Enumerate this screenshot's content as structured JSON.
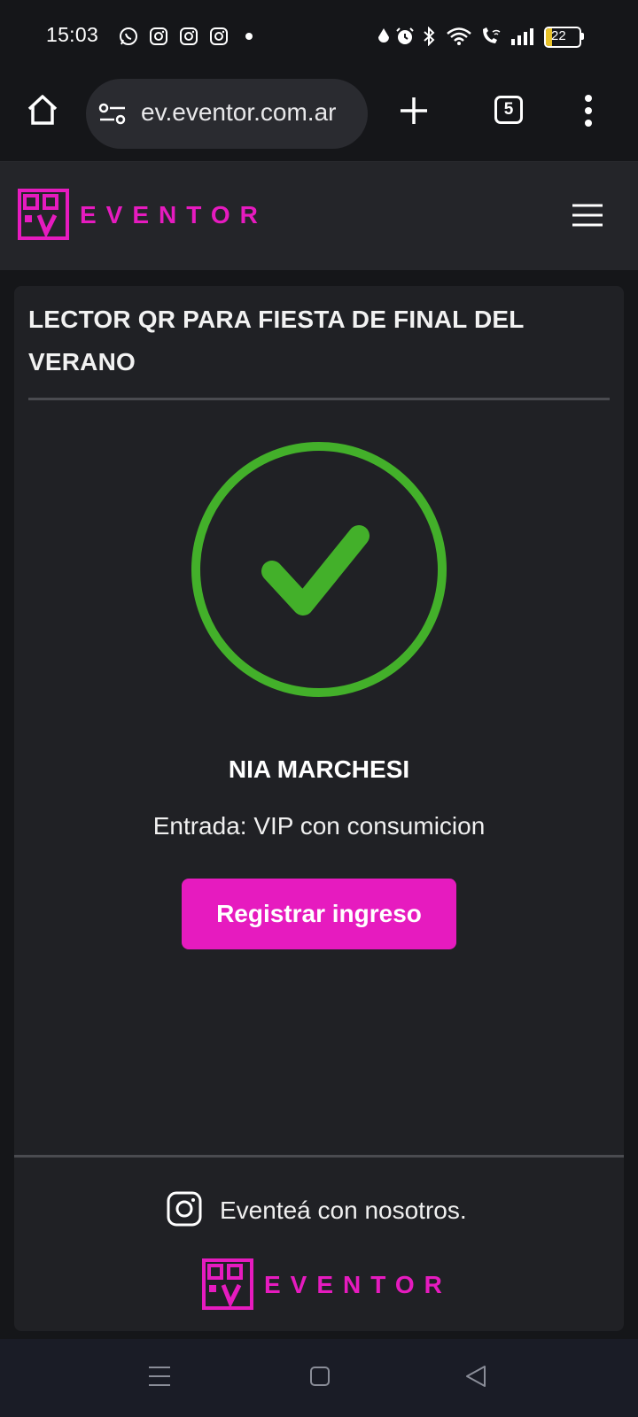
{
  "status_bar": {
    "time": "15:03",
    "battery_level": "22",
    "notification_icons": [
      "whatsapp-icon",
      "instagram-icon",
      "instagram-icon",
      "instagram-icon",
      "dot-icon"
    ],
    "system_icons": [
      "drop-icon",
      "alarm-icon",
      "bluetooth-icon",
      "wifi-icon",
      "wifi-calling-icon",
      "signal-icon",
      "battery-icon"
    ]
  },
  "browser": {
    "url": "ev.eventor.com.ar",
    "tab_count": "5"
  },
  "site": {
    "logo_text": "EVENTOR",
    "accent_color": "#e61bbf"
  },
  "card": {
    "title": "LECTOR QR PARA FIESTA DE FINAL DEL VERANO",
    "status_icon": "check-circle-icon",
    "status_color": "#43b02a",
    "guest_name": "NIA MARCHESI",
    "ticket": "Entrada: VIP con consumicion",
    "register_label": "Registrar ingreso"
  },
  "footer": {
    "text": "Eventeá con nosotros.",
    "logo_text": "EVENTOR"
  },
  "nav_bar": {
    "buttons": [
      "menu-icon",
      "home-icon",
      "back-icon"
    ]
  }
}
